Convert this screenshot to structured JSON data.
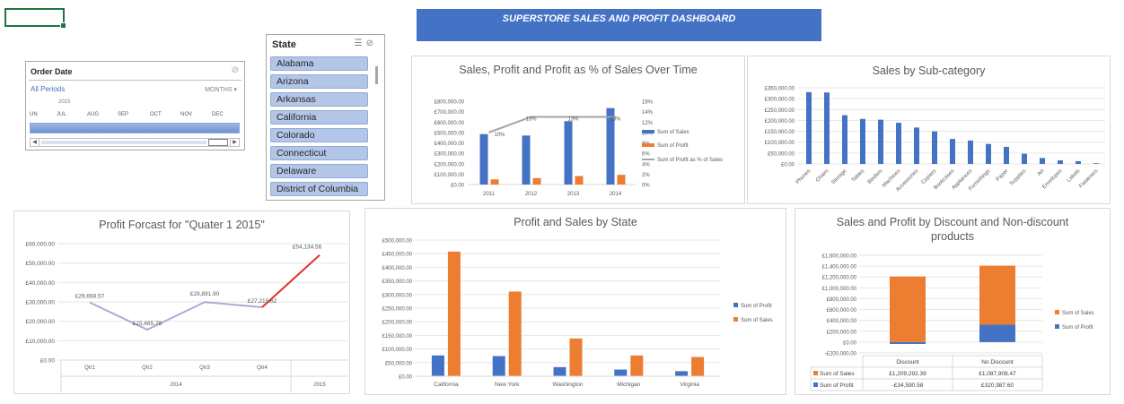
{
  "dashboard_title": "SUPERSTORE SALES AND PROFIT DASHBOARD",
  "timeline": {
    "title": "Order Date",
    "period_label": "All Periods",
    "level_label": "MONTHS",
    "year": "2015",
    "months": [
      "UN",
      "JUL",
      "AUG",
      "SEP",
      "OCT",
      "NOV",
      "DEC"
    ]
  },
  "state_slicer": {
    "title": "State",
    "items": [
      "Alabama",
      "Arizona",
      "Arkansas",
      "California",
      "Colorado",
      "Connecticut",
      "Delaware",
      "District of Columbia"
    ]
  },
  "colors": {
    "blue": "#4472c4",
    "orange": "#ed7d31",
    "gray": "#a5a5a5",
    "purple": "#8064a2",
    "red": "#e03030"
  },
  "chart_data": [
    {
      "id": "over_time",
      "type": "bar",
      "title": "Sales, Profit and Profit as % of Sales Over Time",
      "categories": [
        "2011",
        "2012",
        "2013",
        "2014"
      ],
      "series": [
        {
          "name": "Sum of Sales",
          "values": [
            484247.5,
            470532.51,
            608473.83,
            733947.02
          ]
        },
        {
          "name": "Sum of Profit",
          "values": [
            49543.97,
            61618.6,
            81726.93,
            93507.51
          ]
        },
        {
          "name": "Sum of Profit as % of Sales",
          "type": "line",
          "values": [
            10,
            13,
            13,
            13
          ],
          "labels": [
            "10%",
            "13%",
            "13%",
            "13%"
          ]
        }
      ],
      "y_ticks": [
        "£800,000.00",
        "£700,000.00",
        "£600,000.00",
        "£500,000.00",
        "£400,000.00",
        "£300,000.00",
        "£200,000.00",
        "£100,000.00",
        "£0.00"
      ],
      "y2_ticks": [
        "16%",
        "14%",
        "12%",
        "10%",
        "8%",
        "6%",
        "4%",
        "2%",
        "0%"
      ],
      "ylim": [
        0,
        800000
      ],
      "y2lim": [
        0,
        16
      ],
      "legend_position": "right"
    },
    {
      "id": "subcategory",
      "type": "bar",
      "title": "Sales by Sub-category",
      "categories": [
        "Phones",
        "Chairs",
        "Storage",
        "Tables",
        "Binders",
        "Machines",
        "Accessories",
        "Copiers",
        "Bookcases",
        "Appliances",
        "Furnishings",
        "Paper",
        "Supplies",
        "Art",
        "Envelopes",
        "Labels",
        "Fasteners"
      ],
      "values": [
        330007,
        328449,
        223844,
        206966,
        203413,
        189239,
        167380,
        149528,
        114880,
        107532,
        91705,
        78479,
        46674,
        27119,
        16476,
        12486,
        3024
      ],
      "y_ticks": [
        "£350,000.00",
        "£300,000.00",
        "£250,000.00",
        "£200,000.00",
        "£150,000.00",
        "£100,000.00",
        "£50,000.00",
        "£0.00"
      ],
      "ylim": [
        0,
        350000
      ]
    },
    {
      "id": "forecast",
      "type": "line",
      "title": "Profit Forcast for \"Quater 1 2015\"",
      "categories": [
        "Qtr1",
        "Qtr2",
        "Qtr3",
        "Qtr4",
        ""
      ],
      "groups": [
        {
          "label": "2014",
          "span": 4
        },
        {
          "label": "2015",
          "span": 1
        }
      ],
      "values": [
        29668.57,
        15665.78,
        29891.9,
        27215.62,
        54134.56
      ],
      "labels": [
        "£29,668.57",
        "£15,665.78",
        "£29,891.90",
        "£27,215.62",
        "£54,134.56"
      ],
      "y_ticks": [
        "£60,000.00",
        "£50,000.00",
        "£40,000.00",
        "£30,000.00",
        "£20,000.00",
        "£10,000.00",
        "£0.00"
      ],
      "ylim": [
        0,
        60000
      ]
    },
    {
      "id": "by_state",
      "type": "bar",
      "title": "Profit and Sales by State",
      "categories": [
        "California",
        "New York",
        "Washington",
        "Michigan",
        "Virginia"
      ],
      "series": [
        {
          "name": "Sum of Profit",
          "values": [
            76381.39,
            74038.55,
            33402.65,
            24463.19,
            18597.95
          ]
        },
        {
          "name": "Sum of Sales",
          "values": [
            457687.63,
            310876.27,
            138641.27,
            76269.61,
            70636.72
          ]
        }
      ],
      "y_ticks": [
        "£500,000.00",
        "£450,000.00",
        "£400,000.00",
        "£350,000.00",
        "£300,000.00",
        "£250,000.00",
        "£200,000.00",
        "£150,000.00",
        "£100,000.00",
        "£50,000.00",
        "£0.00"
      ],
      "ylim": [
        0,
        500000
      ],
      "legend_position": "right"
    },
    {
      "id": "discount",
      "type": "bar",
      "title": "Sales and Profit by Discount and Non-discount products",
      "categories": [
        "Discount",
        "No Discount"
      ],
      "series": [
        {
          "name": "Sum of Sales",
          "values": [
            1209292.39,
            1087908.47
          ],
          "labels": [
            "£1,209,292.39",
            "£1,087,908.47"
          ]
        },
        {
          "name": "Sum of Profit",
          "values": [
            -34590.58,
            320987.6
          ],
          "labels": [
            "-£34,590.58",
            "£320,987.60"
          ]
        }
      ],
      "y_ticks": [
        "£1,600,000.00",
        "£1,400,000.00",
        "£1,200,000.00",
        "£1,000,000.00",
        "£800,000.00",
        "£600,000.00",
        "£400,000.00",
        "£200,000.00",
        "£0.00",
        "-£200,000.00"
      ],
      "ylim": [
        -200000,
        1600000
      ],
      "legend_position": "right"
    }
  ]
}
